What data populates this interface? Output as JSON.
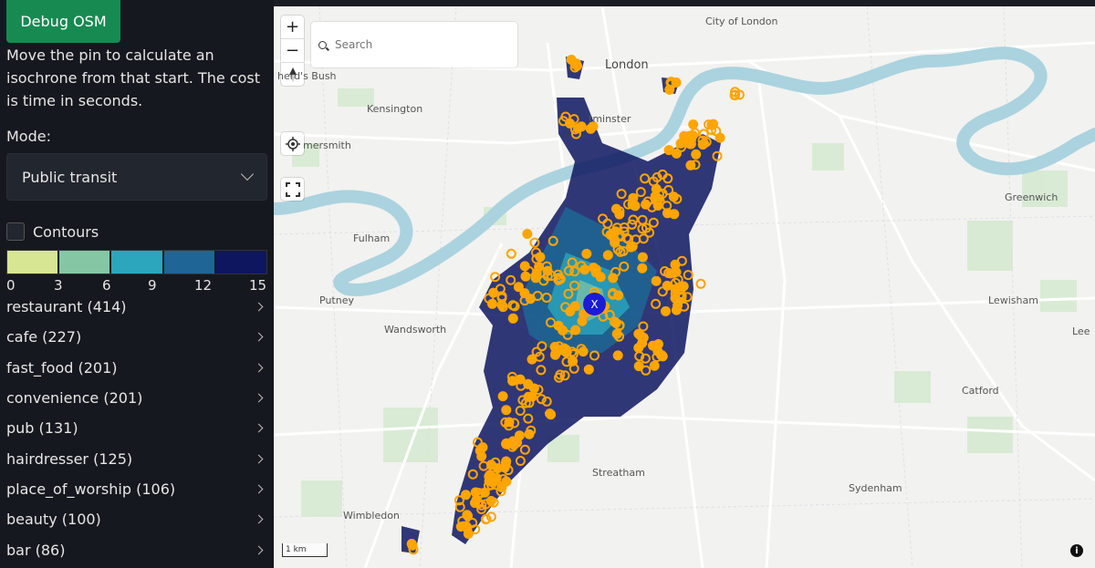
{
  "sidebar": {
    "debug_label": "Debug OSM",
    "description": "Move the pin to calculate an isochrone from that start. The cost is time in seconds.",
    "mode_label": "Mode:",
    "mode_value": "Public transit",
    "contours_label": "Contours",
    "legend_colors": [
      "#d6e692",
      "#85c7a4",
      "#2ba6bd",
      "#1f6595",
      "#0e1660"
    ],
    "legend_ticks": [
      "0",
      "3",
      "6",
      "9",
      "12",
      "15"
    ],
    "amenities": [
      "restaurant (414)",
      "cafe (227)",
      "fast_food (201)",
      "convenience (201)",
      "pub (131)",
      "hairdresser (125)",
      "place_of_worship (106)",
      "beauty (100)",
      "bar (86)"
    ]
  },
  "map": {
    "zoom_in": "+",
    "zoom_out": "−",
    "search_placeholder": "Search",
    "places": {
      "city_of_london": "City of London",
      "london": "London",
      "shepherds_bush": "herd's Bush",
      "kensington": "Kensington",
      "westminster": "tminster",
      "hammersmith": "mersmith",
      "greenwich": "Greenwich",
      "fulham": "Fulham",
      "putney": "Putney",
      "wandsworth": "Wandsworth",
      "lewisham": "Lewisham",
      "lee": "Lee",
      "catford": "Catford",
      "streatham": "Streatham",
      "sydenham": "Sydenham",
      "wimbledon": "Wimbledon"
    },
    "pin_label": "X",
    "scale_label": "1 km",
    "info_label": "i",
    "colors": {
      "river": "#aad3df",
      "isochrone": "#0e1660",
      "poi": "#ffa500",
      "pin": "#1b1bd8"
    }
  }
}
